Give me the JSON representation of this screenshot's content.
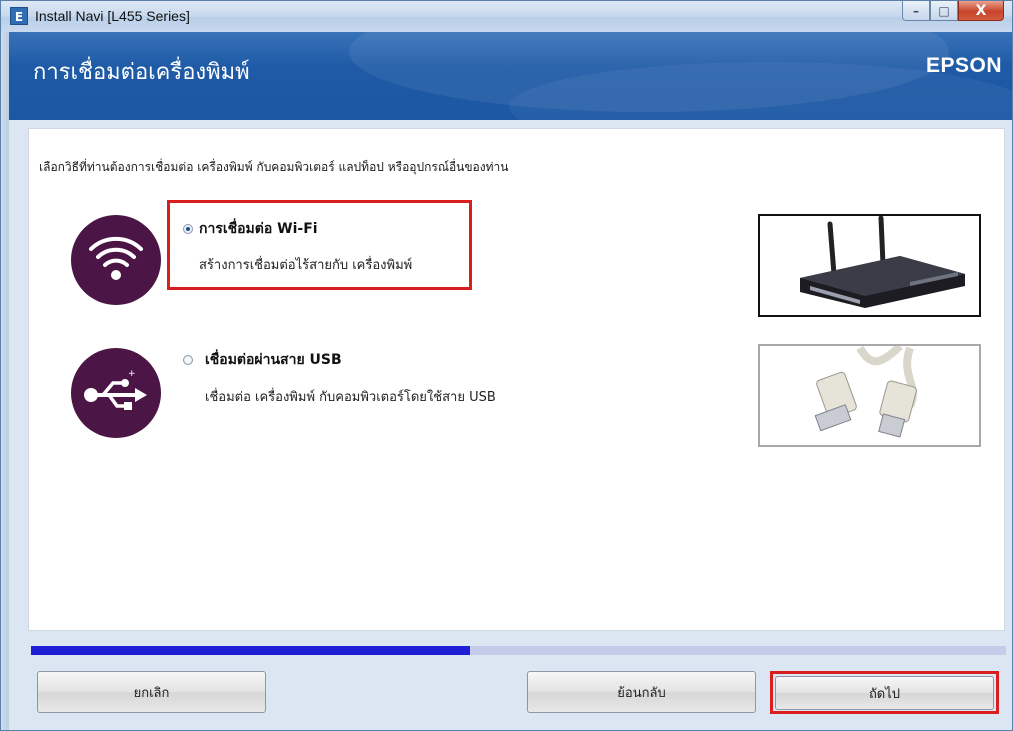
{
  "window": {
    "title": "Install Navi [L455 Series]",
    "app_icon_glyph": "E",
    "controls": {
      "minimize": "–",
      "maximize": "□",
      "close": "X"
    }
  },
  "header": {
    "title": "การเชื่อมต่อเครื่องพิมพ์",
    "brand": "EPSON"
  },
  "main": {
    "instruction": "เลือกวิธีที่ท่านต้องการเชื่อมต่อ เครื่องพิมพ์ กับคอมพิวเตอร์ แลปท็อป หรืออุปกรณ์อื่นของท่าน",
    "options": [
      {
        "title": "การเชื่อมต่อ Wi-Fi",
        "description": "สร้างการเชื่อมต่อไร้สายกับ เครื่องพิมพ์",
        "selected": true,
        "icon": "wifi-icon",
        "image": "router-image"
      },
      {
        "title": "เชื่อมต่อผ่านสาย USB",
        "description": "เชื่อมต่อ เครื่องพิมพ์ กับคอมพิวเตอร์โดยใช้สาย USB",
        "selected": false,
        "icon": "usb-icon",
        "image": "usb-cable-image"
      }
    ]
  },
  "progress": {
    "fraction": 0.45
  },
  "footer": {
    "cancel_label": "ยกเลิก",
    "back_label": "ย้อนกลับ",
    "next_label": "ถัดไป"
  },
  "colors": {
    "header_blue": "#1e5aa6",
    "icon_purple": "#4b1645",
    "highlight_red": "#d81e1e",
    "progress_blue": "#1f1ed6",
    "progress_track": "#c5ccea"
  }
}
